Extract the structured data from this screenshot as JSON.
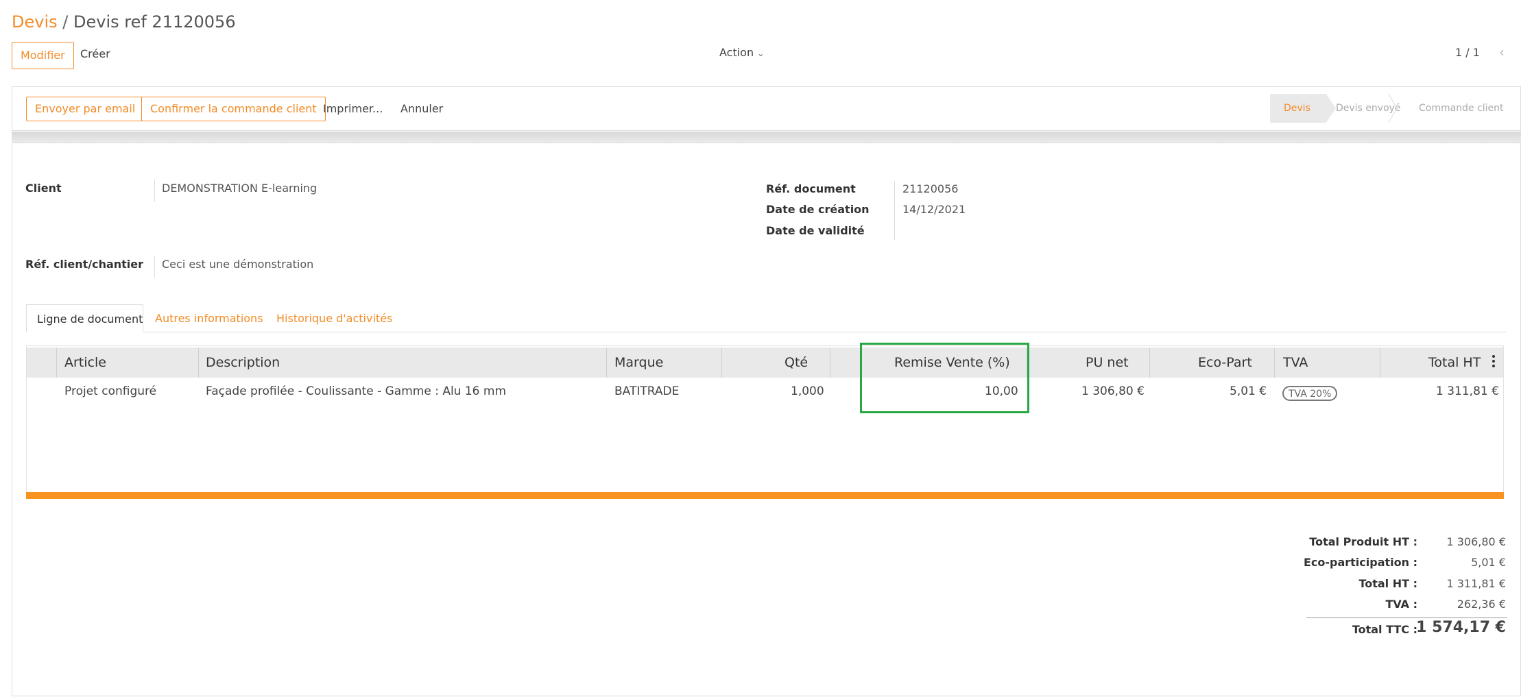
{
  "breadcrumb": {
    "root": "Devis",
    "separator": "/",
    "current": "Devis ref 21120056"
  },
  "toolbar": {
    "edit_label": "Modifier",
    "create_label": "Créer",
    "action_label": "Action",
    "pager": "1 / 1"
  },
  "statusbar": {
    "email_label": "Envoyer par email",
    "confirm_label": "Confirmer la commande client",
    "print_label": "Imprimer...",
    "cancel_label": "Annuler",
    "stages": [
      "Devis",
      "Devis envoyé",
      "Commande client"
    ]
  },
  "form": {
    "client_label": "Client",
    "client_value": "DEMONSTRATION E-learning",
    "ref_client_label": "Réf. client/chantier",
    "ref_client_value": "Ceci est une démonstration",
    "ref_doc_label": "Réf. document",
    "ref_doc_value": "21120056",
    "date_creation_label": "Date de création",
    "date_creation_value": "14/12/2021",
    "date_validite_label": "Date de validité",
    "date_validite_value": ""
  },
  "tabs": [
    "Ligne de document",
    "Autres informations",
    "Historique d'activités"
  ],
  "table": {
    "headers": [
      "Article",
      "Description",
      "Marque",
      "Qté",
      "Remise Vente (%)",
      "PU net",
      "Eco-Part",
      "TVA",
      "Total HT"
    ],
    "rows": [
      [
        "Projet configuré",
        "Façade profilée - Coulissante - Gamme : Alu 16 mm",
        "BATITRADE",
        "1,000",
        "10,00",
        "1 306,80 €",
        "5,01 €",
        "TVA 20%",
        "1 311,81 €"
      ]
    ]
  },
  "totals": {
    "produit_ht_label": "Total Produit HT :",
    "produit_ht_value": "1 306,80 €",
    "eco_label": "Eco-participation :",
    "eco_value": "5,01 €",
    "total_ht_label": "Total HT :",
    "total_ht_value": "1 311,81 €",
    "tva_label": "TVA :",
    "tva_value": "262,36 €",
    "ttc_label": "Total TTC :",
    "ttc_value": "1 574,17 €"
  },
  "colors": {
    "accent": "#f28c28",
    "highlight": "#27a844"
  }
}
